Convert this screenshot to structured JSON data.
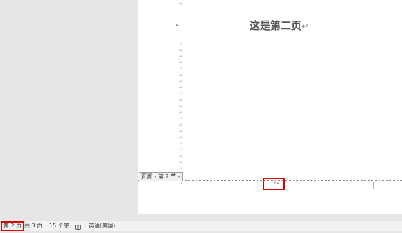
{
  "document": {
    "heading": "这是第二页",
    "paragraph_mark": "↵",
    "footer_tab_label": "页脚 - 第 2 节 -",
    "footer_page_number": "1↵"
  },
  "status_bar": {
    "page": "第 2 页",
    "total_pages": "共 3 页",
    "word_count": "15 个字",
    "proofing_icon": "book-icon",
    "language": "英语(美国)"
  },
  "colors": {
    "workspace": "#e6e6e6",
    "page": "#ffffff",
    "highlight_box": "#e00000",
    "statusbar": "#f3f3f3"
  }
}
